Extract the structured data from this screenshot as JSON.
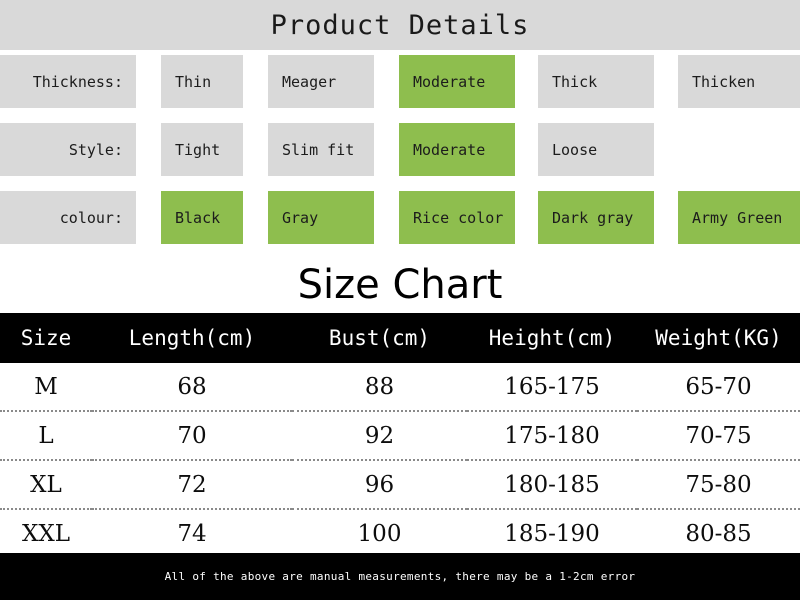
{
  "header": {
    "title": "Product Details",
    "band_color": "#d9d9d9"
  },
  "theme": {
    "cell_background": "#d9d9d9",
    "selected_background": "#8ebe4e",
    "table_header_background": "#000000",
    "table_header_text": "#ffffff",
    "footer_background": "#000000",
    "page_background": "#ffffff"
  },
  "attributes": [
    {
      "label": "Thickness:",
      "options": [
        {
          "label": "Thin",
          "selected": false
        },
        {
          "label": "Meager",
          "selected": false
        },
        {
          "label": "Moderate",
          "selected": true
        },
        {
          "label": "Thick",
          "selected": false
        },
        {
          "label": "Thicken",
          "selected": false
        }
      ]
    },
    {
      "label": "Style:",
      "options": [
        {
          "label": "Tight",
          "selected": false
        },
        {
          "label": "Slim fit",
          "selected": false
        },
        {
          "label": "Moderate",
          "selected": true
        },
        {
          "label": "Loose",
          "selected": false
        }
      ]
    },
    {
      "label": "colour:",
      "options": [
        {
          "label": "Black",
          "selected": true
        },
        {
          "label": "Gray",
          "selected": true
        },
        {
          "label": "Rice color",
          "selected": true
        },
        {
          "label": "Dark gray",
          "selected": true
        },
        {
          "label": "Army Green",
          "selected": true
        }
      ]
    }
  ],
  "size_chart": {
    "title": "Size Chart",
    "columns": [
      "Size",
      "Length(cm)",
      "Bust(cm)",
      "Height(cm)",
      "Weight(KG)"
    ],
    "rows": [
      {
        "size": "M",
        "length": "68",
        "bust": "88",
        "height": "165-175",
        "weight": "65-70"
      },
      {
        "size": "L",
        "length": "70",
        "bust": "92",
        "height": "175-180",
        "weight": "70-75"
      },
      {
        "size": "XL",
        "length": "72",
        "bust": "96",
        "height": "180-185",
        "weight": "75-80"
      },
      {
        "size": "XXL",
        "length": "74",
        "bust": "100",
        "height": "185-190",
        "weight": "80-85"
      }
    ],
    "footer_note": "All of the above are manual measurements,  there may be a 1-2cm error"
  }
}
